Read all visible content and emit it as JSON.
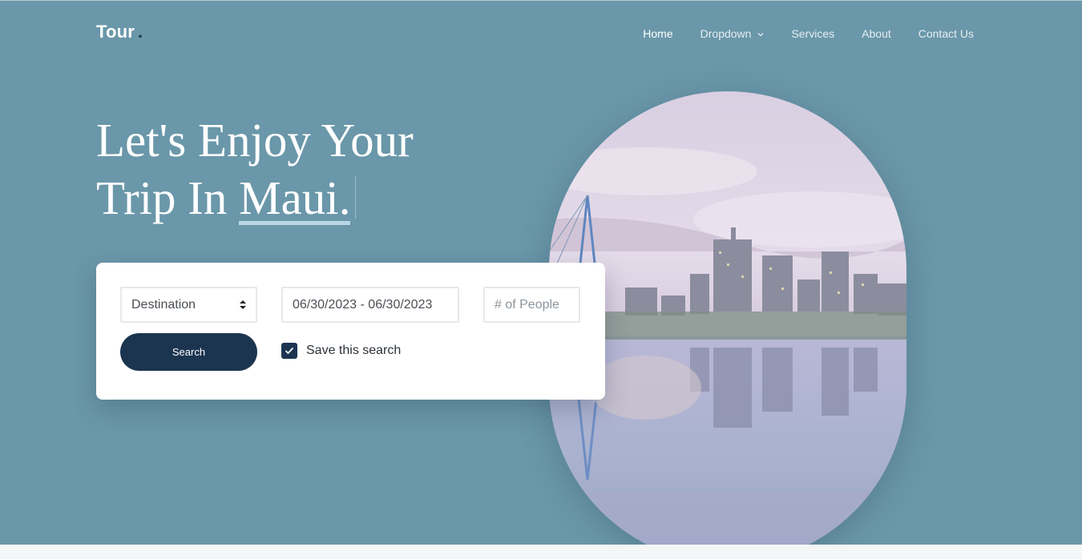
{
  "brand": {
    "name": "Tour",
    "dot": "."
  },
  "nav": {
    "items": [
      {
        "label": "Home",
        "active": true
      },
      {
        "label": "Dropdown",
        "has_dropdown": true
      },
      {
        "label": "Services"
      },
      {
        "label": "About"
      },
      {
        "label": "Contact Us"
      }
    ]
  },
  "hero": {
    "line1": "Let's Enjoy Your",
    "line2_prefix": "Trip In ",
    "place": "Maui."
  },
  "search": {
    "destination_value": "Destination",
    "date_range_value": "06/30/2023 - 06/30/2023",
    "people_placeholder": "# of People",
    "search_button": "Search",
    "save_label": "Save this search",
    "save_checked": true
  },
  "colors": {
    "hero_bg": "#6a97a9",
    "primary_dark": "#1b3550",
    "underline": "#b9d6e4"
  },
  "icons": {
    "dropdown": "chevron-down-icon",
    "select": "sort-arrows-icon",
    "check": "check-icon"
  }
}
